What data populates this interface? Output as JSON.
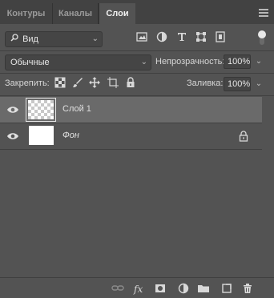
{
  "tabs": [
    {
      "label": "Контуры"
    },
    {
      "label": "Каналы"
    },
    {
      "label": "Слои"
    }
  ],
  "filter": {
    "kind_label": "Вид",
    "icons": [
      "image-filter-icon",
      "adjustment-filter-icon",
      "type-filter-icon",
      "shape-filter-icon",
      "smart-object-filter-icon"
    ]
  },
  "blend": {
    "mode": "Обычные",
    "opacity_label": "Непрозрачность:",
    "opacity_value": "100%"
  },
  "lock": {
    "label": "Закрепить:",
    "fill_label": "Заливка:",
    "fill_value": "100%"
  },
  "layers": [
    {
      "name": "Слой 1",
      "visible": true,
      "selected": true,
      "transparent": true
    },
    {
      "name": "Фон",
      "visible": true,
      "selected": false,
      "locked": true,
      "italic": true
    }
  ],
  "colors": {
    "panel": "#535353",
    "tabbar": "#424242",
    "selected_layer": "#6a6a6a"
  }
}
